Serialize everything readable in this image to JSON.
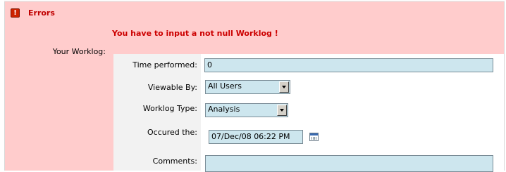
{
  "errors": {
    "title": "Errors",
    "message": "You have to input a not null Worklog !"
  },
  "form": {
    "section_label": "Your Worklog:",
    "time_performed": {
      "label": "Time performed:",
      "value": "0"
    },
    "viewable_by": {
      "label": "Viewable By:",
      "selected": "All Users"
    },
    "worklog_type": {
      "label": "Worklog Type:",
      "selected": "Analysis"
    },
    "occured_the": {
      "label": "Occured the:",
      "value": "07/Dec/08 06:22 PM"
    },
    "comments": {
      "label": "Comments:",
      "value": ""
    }
  },
  "icons": {
    "error": "error-icon",
    "calendar": "calendar-icon",
    "dropdown": "chevron-down-icon"
  },
  "colors": {
    "panel_background": "#ffcccc",
    "error_text": "#cc0000",
    "input_background": "#cde6ee"
  }
}
